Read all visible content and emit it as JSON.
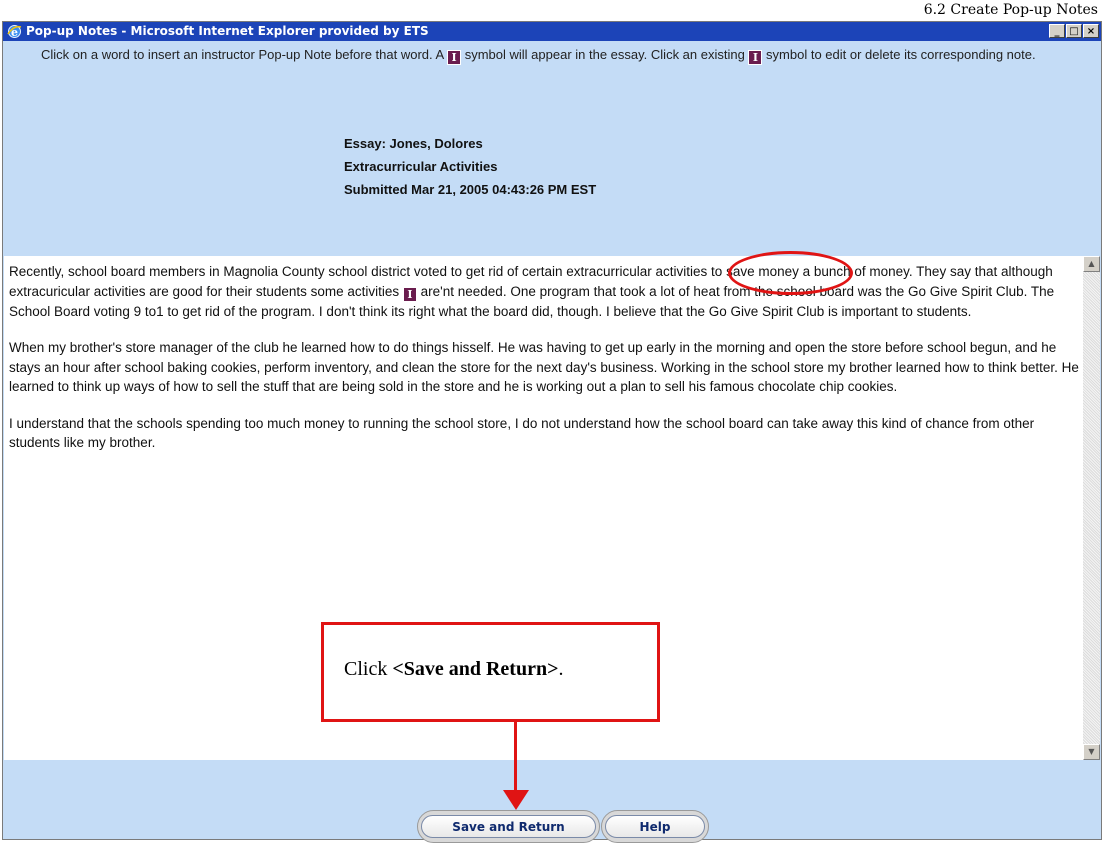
{
  "page_header": "6.2 Create Pop-up Notes",
  "window": {
    "title": "Pop-up Notes - Microsoft Internet Explorer provided by ETS",
    "buttons": {
      "minimize": "_",
      "maximize": "□",
      "close": "×"
    }
  },
  "instructions": {
    "part1": "Click on a word to insert an instructor Pop-up Note before that word. A ",
    "part2": " symbol will appear in the essay. Click an existing ",
    "part3": " symbol to edit or delete its corresponding note.",
    "symbol": "I"
  },
  "essay": {
    "header_line1": "Essay: Jones, Dolores",
    "header_line2": "Extracurricular Activities",
    "header_line3": "Submitted Mar 21, 2005 04:43:26 PM EST",
    "p1_a": "Recently, school board members in Magnolia County school district voted to get rid of certain extracurricular activities to save money a bunch of money. They say that although extracuricular activities are good for their students some activities ",
    "p1_symbol": "I",
    "p1_b": " are'nt needed. One program that took a lot of heat from the school board was the Go Give Spirit Club. The School Board voting 9 to1 to get rid of the program. I don't think its right what the board did, though. I believe that the Go Give Spirit Club is important to students.",
    "p2": "When my brother's store manager of the club he learned how to do things hisself. He was having to get up early in the morning and open the store before school begun, and he stays an hour after school baking cookies, perform inventory, and clean the store for the next day's business. Working in the school store my brother learned how to think better. He learned to think up ways of how to sell the stuff that are being sold in the store and he is working out a plan to sell his famous chocolate chip cookies.",
    "p3": "I understand that the schools spending too much money to running the school store, I do not understand how the school board can take away this kind of chance from other students like my brother."
  },
  "callout": {
    "prefix": "Click ",
    "bold": "<Save and Return>",
    "suffix": "."
  },
  "buttons": {
    "save_and_return": "Save and Return",
    "help": "Help"
  },
  "colors": {
    "accent": "#e01414",
    "title_bar": "#1c44b8",
    "panel": "#c4dcf6",
    "note_symbol": "#6a1c4e"
  }
}
